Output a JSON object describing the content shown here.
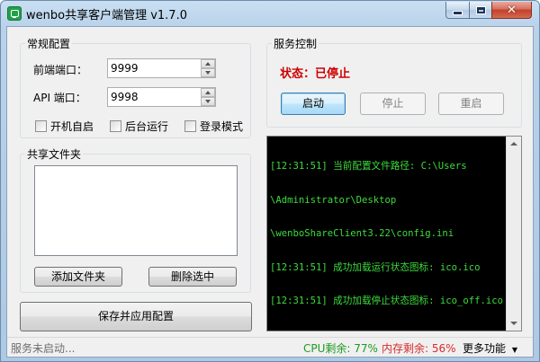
{
  "window": {
    "title": "wenbo共享客户端管理 v1.7.0"
  },
  "general": {
    "title": "常规配置",
    "frontend_port_label": "前端端口：",
    "frontend_port_value": "9999",
    "api_port_label": "API 端口：",
    "api_port_value": "9998",
    "autostart_label": "开机自启",
    "background_label": "后台运行",
    "login_mode_label": "登录模式"
  },
  "shared_folders": {
    "title": "共享文件夹",
    "add_label": "添加文件夹",
    "delete_label": "删除选中"
  },
  "save_label": "保存并应用配置",
  "service": {
    "title": "服务控制",
    "status": "状态：已停止",
    "start_label": "启动",
    "stop_label": "停止",
    "restart_label": "重启"
  },
  "log_lines": [
    "[12:31:51] 当前配置文件路径: C:\\Users",
    "\\Administrator\\Desktop",
    "\\wenboShareClient3.22\\config.ini",
    "[12:31:51] 成功加载运行状态图标: ico.ico",
    "[12:31:51] 成功加载停止状态图标: ico_off.ico"
  ],
  "statusbar": {
    "message": "服务未启动...",
    "cpu": "CPU剩余: 77%",
    "memory": "内存剩余: 56%",
    "more": "更多功能",
    "cpu_color": "#1e9a1e",
    "memory_color": "#d92b2b"
  }
}
